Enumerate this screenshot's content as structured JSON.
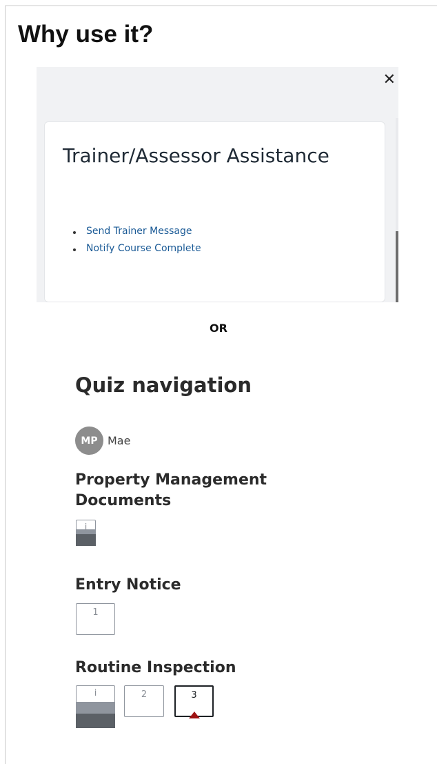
{
  "heading": "Why use it?",
  "drawer": {
    "close_icon": "close-icon",
    "card_title": "Trainer/Assessor Assistance",
    "links": [
      "Send Trainer Message",
      "Notify Course Complete"
    ]
  },
  "separator": "OR",
  "quiz_nav": {
    "title": "Quiz navigation",
    "user": {
      "initials": "MP",
      "name": "Mae"
    },
    "sections": [
      {
        "title": "Property Management Documents",
        "buttons": [
          {
            "label": "i",
            "kind": "info"
          }
        ]
      },
      {
        "title": "Entry Notice",
        "buttons": [
          {
            "label": "1",
            "kind": "question"
          }
        ]
      },
      {
        "title": "Routine Inspection",
        "buttons": [
          {
            "label": "i",
            "kind": "info"
          },
          {
            "label": "2",
            "kind": "question"
          },
          {
            "label": "3",
            "kind": "current-flagged"
          }
        ]
      }
    ]
  },
  "colors": {
    "link": "#1a5a96",
    "flag": "#9e1212",
    "info_fill": "#5b6066",
    "avatar": "#8d8d8d"
  }
}
